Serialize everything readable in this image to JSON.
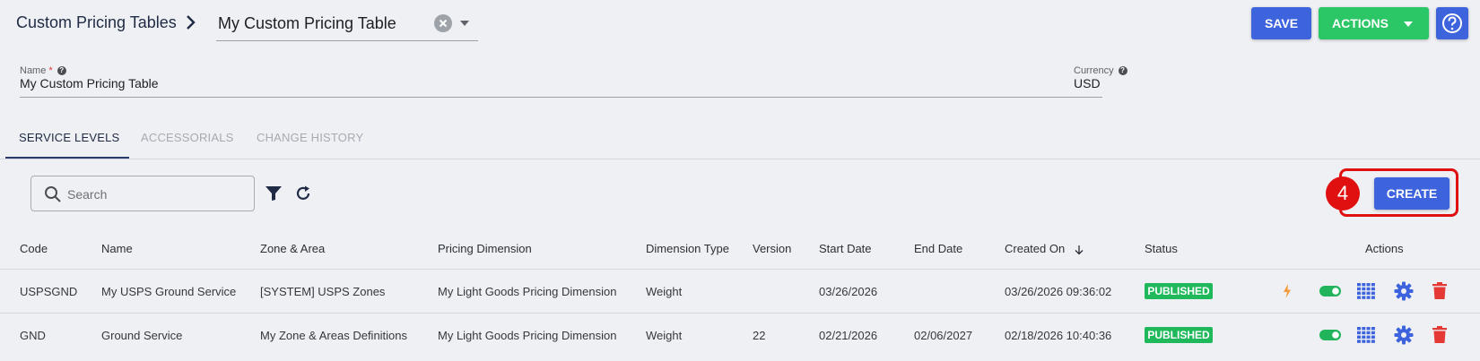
{
  "header": {
    "breadcrumb_root": "Custom Pricing Tables",
    "selected_table": "My Custom Pricing Table",
    "save_label": "SAVE",
    "actions_label": "ACTIONS"
  },
  "form": {
    "name_label": "Name",
    "name_required_mark": "*",
    "name_value": "My Custom Pricing Table",
    "currency_label": "Currency",
    "currency_value": "USD"
  },
  "tabs": [
    {
      "label": "SERVICE LEVELS",
      "active": true
    },
    {
      "label": "ACCESSORIALS",
      "active": false
    },
    {
      "label": "CHANGE HISTORY",
      "active": false
    }
  ],
  "toolbar": {
    "search_placeholder": "Search",
    "search_value": "",
    "create_label": "CREATE",
    "callout_number": "4"
  },
  "table": {
    "columns": [
      "Code",
      "Name",
      "Zone & Area",
      "Pricing Dimension",
      "Dimension Type",
      "Version",
      "Start Date",
      "End Date",
      "Created On",
      "Status",
      "Actions"
    ],
    "sorted_column": "Created On",
    "sort_direction": "descending",
    "rows": [
      {
        "code": "USPSGND",
        "name": "My USPS Ground Service",
        "zone": "[SYSTEM] USPS Zones",
        "pricing_dimension": "My Light Goods Pricing Dimension",
        "dimension_type": "Weight",
        "version": "",
        "start_date": "03/26/2026",
        "end_date": "",
        "created_on": "03/26/2026 09:36:02",
        "status": "PUBLISHED"
      },
      {
        "code": "GND",
        "name": "Ground Service",
        "zone": "My Zone & Areas Definitions",
        "pricing_dimension": "My Light Goods Pricing Dimension",
        "dimension_type": "Weight",
        "version": "22",
        "start_date": "02/21/2026",
        "end_date": "02/06/2027",
        "created_on": "02/18/2026 10:40:36",
        "status": "PUBLISHED"
      }
    ]
  },
  "colors": {
    "primary": "#3d63dd",
    "success": "#2bc665",
    "badge": "#1fb95c",
    "delete": "#e53935",
    "callout": "#e01010"
  }
}
